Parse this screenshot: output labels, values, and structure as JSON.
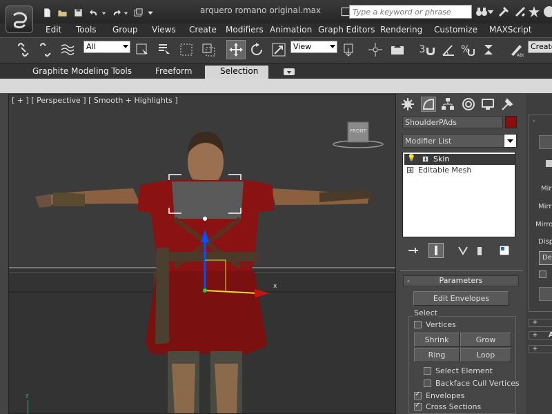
{
  "window": {
    "title": "arquero romano original.max",
    "search_placeholder": "Type a keyword or phrase"
  },
  "menu": [
    "Edit",
    "Tools",
    "Group",
    "Views",
    "Create",
    "Modifiers",
    "Animation",
    "Graph Editors",
    "Rendering",
    "Customize",
    "MAXScript"
  ],
  "toolbar": {
    "selection_filter": "All",
    "ref_coord": "View",
    "snap_number": "3",
    "create_sel_set": "Create"
  },
  "ribbon": {
    "tabs": [
      "Graphite Modeling Tools",
      "Freeform",
      "Selection"
    ],
    "active_tab": "Selection"
  },
  "viewport": {
    "label": "[ + ] [ Perspective ] [ Smooth + Highlights ]",
    "viewcube_face": "FRONT",
    "gizmo_x": "x",
    "gizmo_z": "z"
  },
  "command_panel": {
    "object_name": "ShoulderPAds",
    "object_color": "#8b0d0d",
    "modifier_list": "Modifier List",
    "stack": [
      {
        "label": "Skin",
        "selected": true
      },
      {
        "label": "Editable Mesh",
        "selected": false
      }
    ],
    "params_title": "Parameters",
    "params_toggle": "-",
    "edit_envelopes": "Edit Envelopes",
    "select_group": "Select",
    "vertices": "Vertices",
    "shrink": "Shrink",
    "grow": "Grow",
    "ring": "Ring",
    "loop": "Loop",
    "select_element": "Select Element",
    "backface": "Backface Cull Vertices",
    "envelopes": "Envelopes",
    "cross_sections": "Cross Sections"
  },
  "right_strip": {
    "labels": [
      "Mirr",
      "Mirr",
      "Mirro",
      "Disp",
      "De"
    ],
    "rollouts": [
      "+",
      "+",
      "+"
    ],
    "rollout_letter": "A",
    "top_toggle": "-"
  },
  "colors": {
    "accent": "#0050ff",
    "tunic": "#8b1212"
  }
}
